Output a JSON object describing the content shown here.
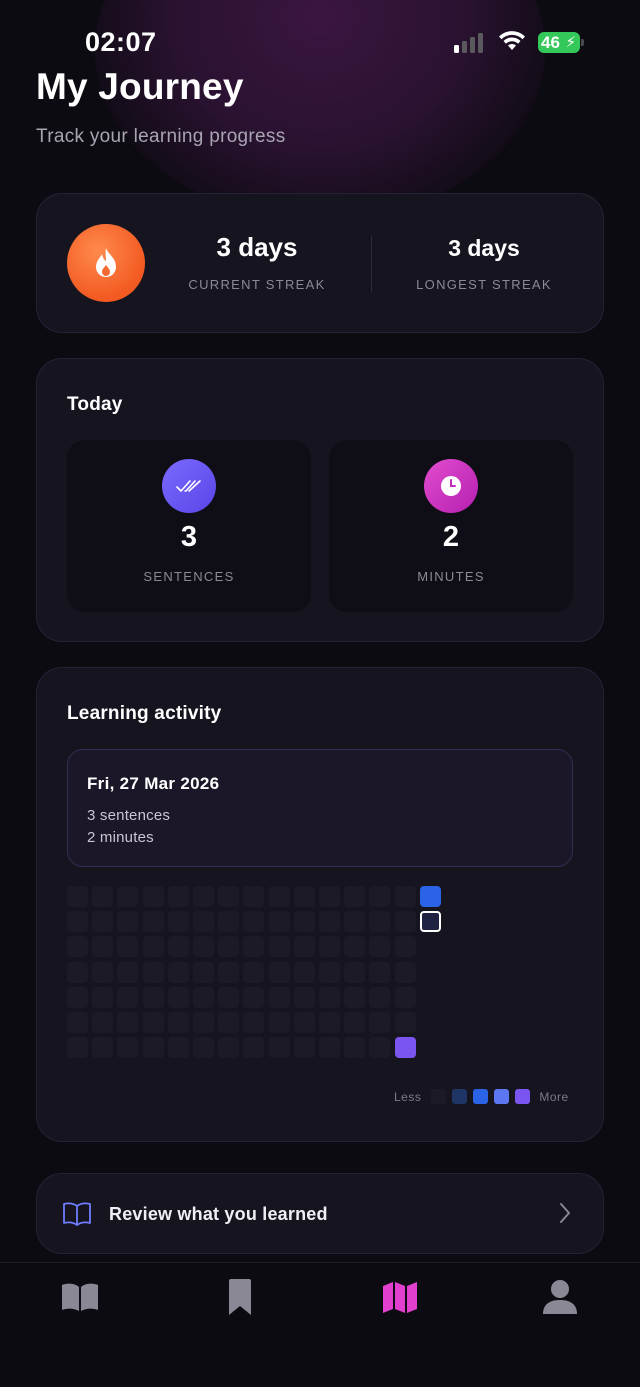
{
  "status_bar": {
    "time": "02:07",
    "battery": "46",
    "signal_bars_active": 1,
    "icons": [
      "cellular-signal-icon",
      "wifi-icon",
      "battery-charging-icon"
    ]
  },
  "header": {
    "title": "My Journey",
    "subtitle": "Track your learning progress"
  },
  "streak": {
    "icon": "flame-icon",
    "current_value": "3 days",
    "current_label": "CURRENT STREAK",
    "longest_value": "3 days",
    "longest_label": "LONGEST STREAK"
  },
  "today": {
    "title": "Today",
    "sentences_value": "3",
    "sentences_label": "SENTENCES",
    "minutes_value": "2",
    "minutes_label": "MINUTES",
    "icons": [
      "double-check-icon",
      "clock-icon"
    ]
  },
  "activity": {
    "title": "Learning activity",
    "tooltip": {
      "date": "Fri, 27 Mar 2026",
      "line1": "3 sentences",
      "line2": "2 minutes"
    },
    "heatmap": {
      "rows": 7,
      "columns": 15,
      "last_column_filled_rows": 2,
      "highlighted": [
        {
          "row": 0,
          "col": 14,
          "level": 2
        },
        {
          "row": 1,
          "col": 14,
          "level": 0,
          "selected": true
        },
        {
          "row": 6,
          "col": 13,
          "level": 4
        }
      ]
    },
    "legend": {
      "less": "Less",
      "more": "More",
      "colors": [
        "#1d1a27",
        "#1f3566",
        "#2a63e6",
        "#5b78f2",
        "#7b55f0"
      ]
    }
  },
  "review": {
    "icon": "open-book-icon",
    "label": "Review what you learned"
  },
  "tabbar": {
    "tabs": [
      {
        "icon": "book-icon",
        "active": false
      },
      {
        "icon": "bookmark-icon",
        "active": false
      },
      {
        "icon": "map-icon",
        "active": true
      },
      {
        "icon": "profile-icon",
        "active": false
      }
    ]
  },
  "colors": {
    "background": "#0d0b12",
    "card": "#16141f",
    "accent_purple": "#6c5cf5",
    "accent_pink": "#d23bc6",
    "flame_orange": "#f25a22"
  }
}
